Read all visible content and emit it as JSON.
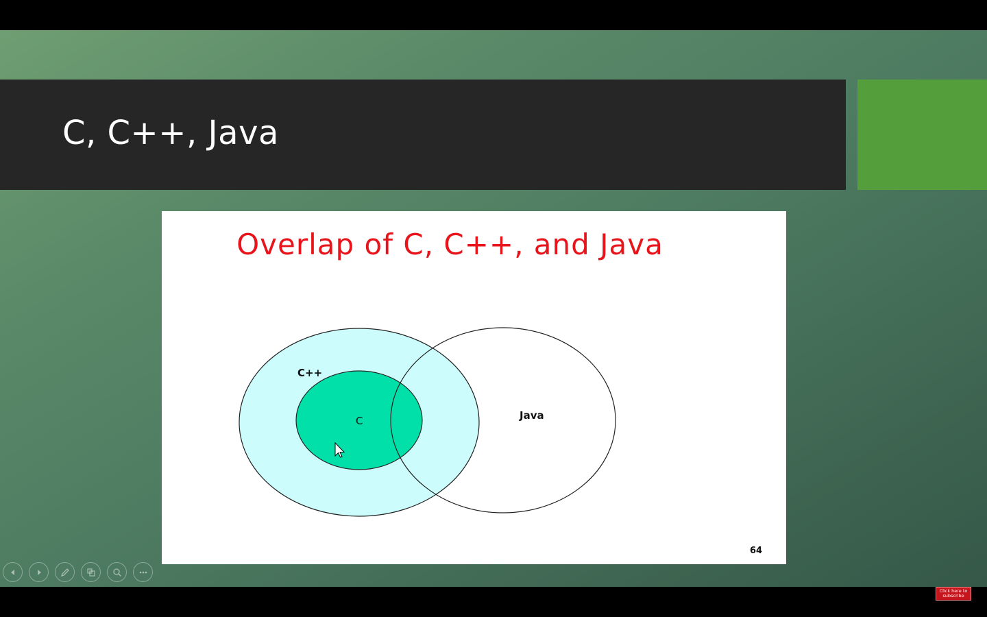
{
  "slide": {
    "title": "C, C++, Java",
    "accent_color": "#549e3c",
    "image": {
      "heading": "Overlap of C, C++, and Java",
      "heading_color": "#e8141c",
      "venn": {
        "labels": {
          "cpp": "C++",
          "c": "C",
          "java": "Java"
        },
        "colors": {
          "cpp_fill": "#ccfcfc",
          "c_fill": "#00e0a8",
          "java_fill": "#ffffff"
        }
      },
      "page_number": "64"
    }
  },
  "controls": {
    "icons": [
      "previous-icon",
      "next-icon",
      "pen-icon",
      "slides-grid-icon",
      "zoom-icon",
      "more-options-icon"
    ]
  },
  "subscribe": {
    "line1": "Click here to",
    "line2": "subscribe"
  }
}
